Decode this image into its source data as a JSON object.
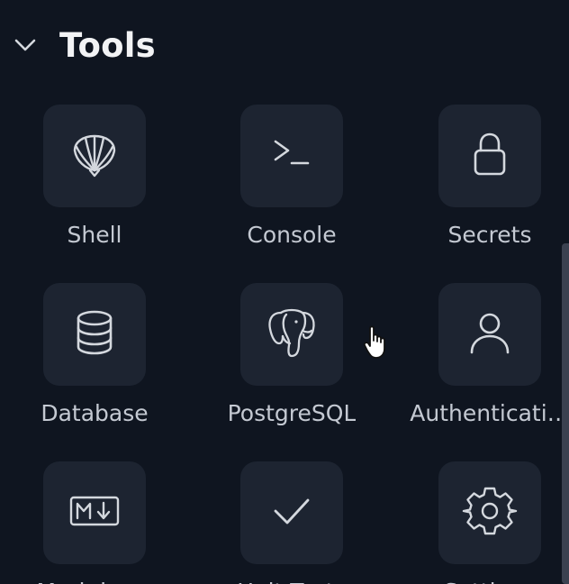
{
  "section": {
    "title": "Tools",
    "expanded": true
  },
  "tools": [
    {
      "label": "Shell",
      "icon": "shell-icon"
    },
    {
      "label": "Console",
      "icon": "console-icon"
    },
    {
      "label": "Secrets",
      "icon": "lock-icon"
    },
    {
      "label": "Database",
      "icon": "database-icon"
    },
    {
      "label": "PostgreSQL",
      "icon": "postgresql-elephant-icon"
    },
    {
      "label": "Authenticati…",
      "icon": "user-icon"
    },
    {
      "label": "Markdown",
      "icon": "markdown-icon"
    },
    {
      "label": "Unit Tests",
      "icon": "checkmark-icon"
    },
    {
      "label": "Settings",
      "icon": "gear-icon"
    }
  ],
  "colors": {
    "background": "#0f1520",
    "tile": "#1d2431",
    "icon": "#d4d8de",
    "label": "#c4c9d2",
    "scrollbar": "#3b4150"
  }
}
